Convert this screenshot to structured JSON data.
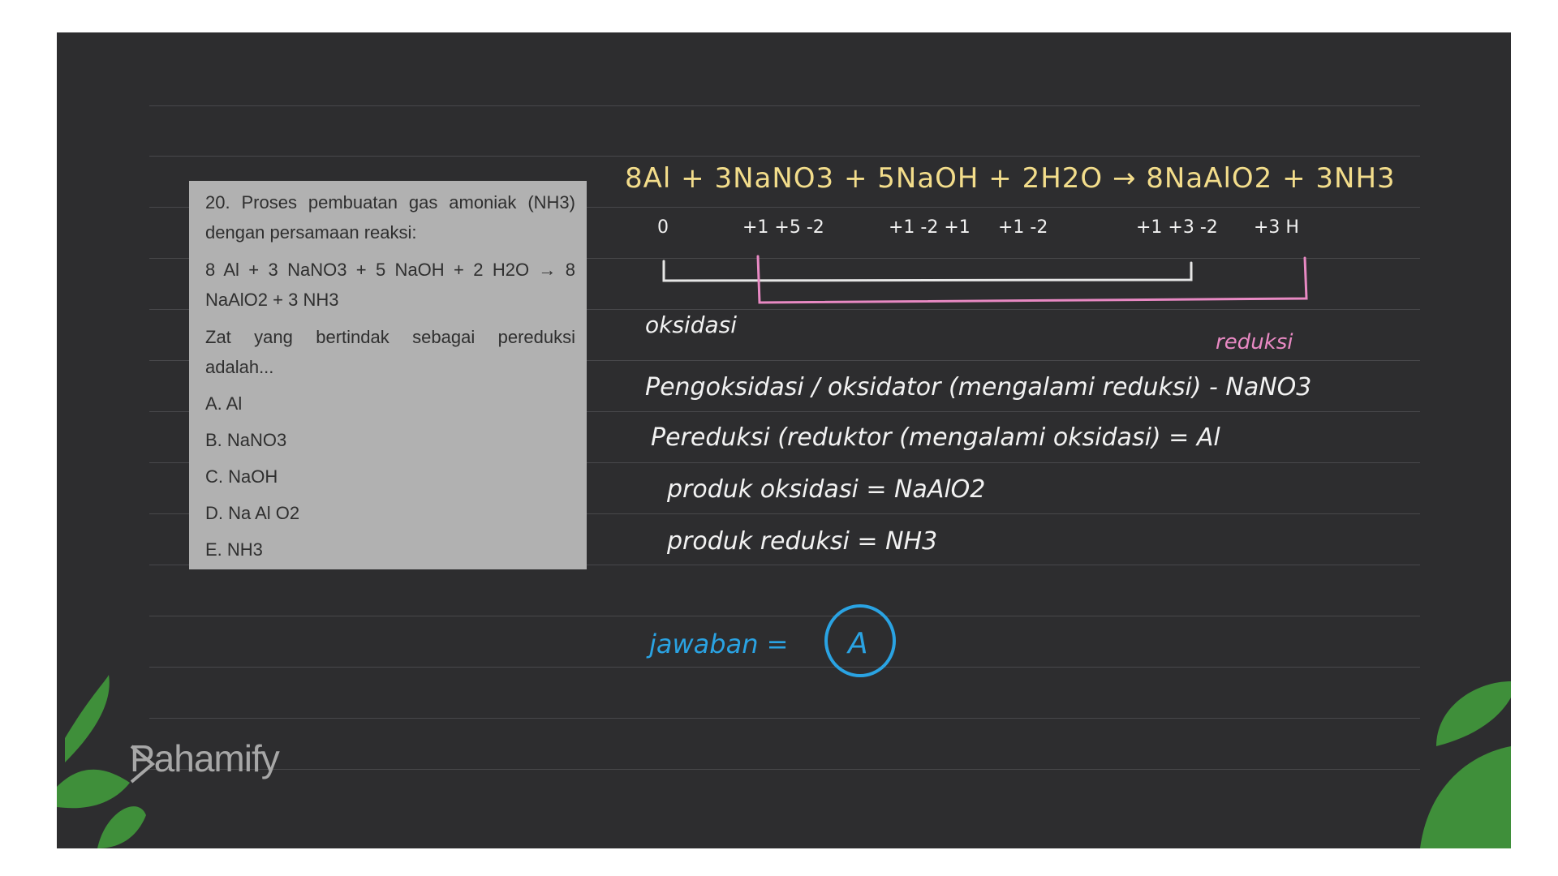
{
  "question": {
    "stem": "20. Proses pembuatan gas amoniak (NH3) dengan persamaan reaksi:",
    "equation": "8 Al + 3 NaNO3 + 5 NaOH + 2 H2O → 8 NaAlO2 + 3 NH3",
    "prompt": "Zat yang bertindak sebagai pereduksi adalah...",
    "options": [
      "A. Al",
      "B. NaNO3",
      "C. NaOH",
      "D. Na Al O2",
      "E. NH3"
    ]
  },
  "solution": {
    "equation": "8Al + 3NaNO3 + 5NaOH + 2H2O → 8NaAlO2 + 3NH3",
    "oxidation_numbers": [
      "0",
      "+1 +5 -2",
      "+1 -2 +1",
      "+1 -2",
      "+1 +3 -2",
      "+3 H"
    ],
    "label_oxidation": "oksidasi",
    "label_reduction": "reduksi",
    "line_oxidizer": "Pengoksidasi / oksidator (mengalami reduksi) - NaNO3",
    "line_reducer": "Pereduksi (reduktor (mengalami oksidasi) = Al",
    "line_ox_product": "produk oksidasi = NaAlO2",
    "line_red_product": "produk reduksi = NH3",
    "answer_label": "jawaban =",
    "answer": "A"
  },
  "brand": {
    "logo_text": "Pahamify"
  },
  "colors": {
    "board": "#2d2d2f",
    "equation": "#f3dd8b",
    "reduction": "#e889c3",
    "answer": "#2aa3e3",
    "leaf": "#3f8f3a"
  }
}
